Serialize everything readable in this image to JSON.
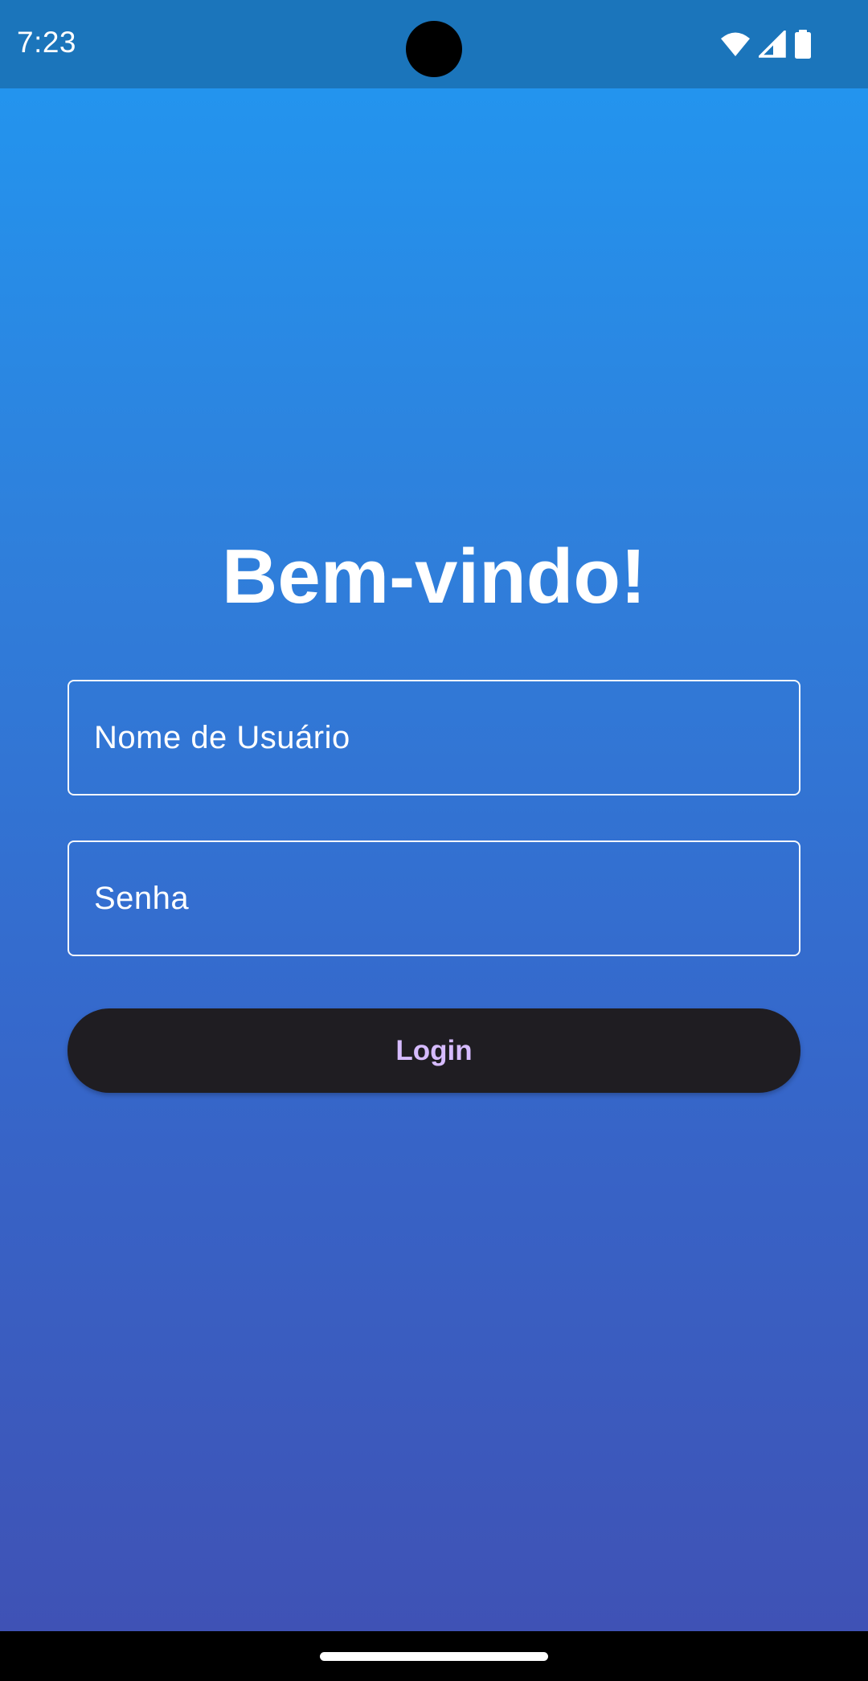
{
  "status_bar": {
    "time": "7:23",
    "icons": [
      "wifi-icon",
      "cell-signal-icon",
      "battery-icon"
    ],
    "background_color": "#1b75bb"
  },
  "screen": {
    "title": "Bem-vindo!",
    "username_field": {
      "placeholder": "Nome de Usuário",
      "value": ""
    },
    "password_field": {
      "placeholder": "Senha",
      "value": ""
    },
    "login_button": {
      "label": "Login"
    },
    "gradient_top_color": "#2394ee",
    "gradient_bottom_color": "#3f52b5",
    "button_color": "#1f1d22",
    "button_text_color": "#d6bbff"
  },
  "nav_bar": {
    "handle": "gesture-handle"
  }
}
